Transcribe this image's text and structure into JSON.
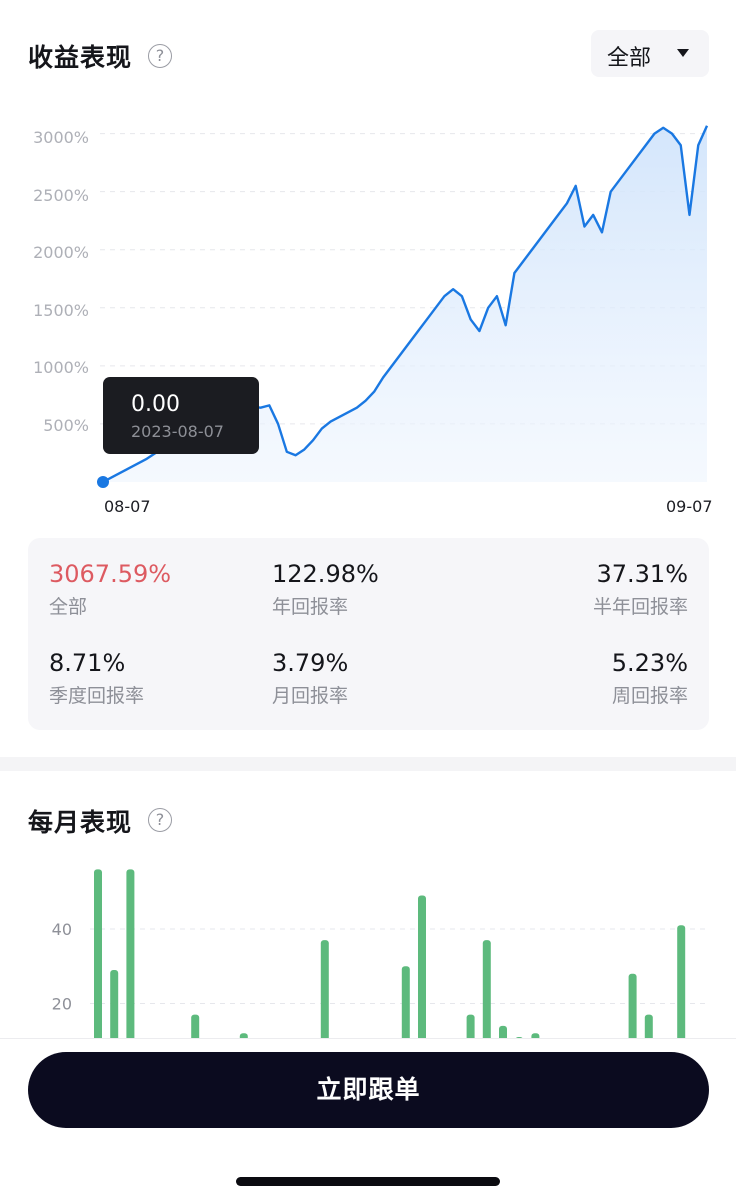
{
  "performance": {
    "title": "收益表现",
    "range_selector": "全部",
    "chart_data": {
      "type": "area",
      "x": [
        "08-07",
        "09-07"
      ],
      "ylabel": "",
      "yticks": [
        "500%",
        "1000%",
        "1500%",
        "2000%",
        "2500%",
        "3000%"
      ],
      "ylim": [
        0,
        3100
      ],
      "grid": true,
      "series": [
        {
          "values": [
            0,
            40,
            80,
            120,
            160,
            200,
            250,
            300,
            320,
            360,
            380,
            390,
            400,
            420,
            440,
            560,
            620,
            650,
            640,
            660,
            500,
            260,
            230,
            280,
            360,
            460,
            520,
            560,
            600,
            640,
            700,
            780,
            900,
            1000,
            1100,
            1200,
            1300,
            1400,
            1500,
            1600,
            1660,
            1600,
            1400,
            1300,
            1500,
            1600,
            1350,
            1800,
            1900,
            2000,
            2100,
            2200,
            2300,
            2400,
            2550,
            2200,
            2300,
            2150,
            2500,
            2600,
            2700,
            2800,
            2900,
            3000,
            3050,
            3000,
            2900,
            2300,
            2900,
            3067.59
          ]
        }
      ],
      "color": "#1a78e2"
    },
    "tooltip": {
      "value": "0.00",
      "date": "2023-08-07"
    },
    "stats": [
      {
        "value": "3067.59%",
        "label": "全部"
      },
      {
        "value": "122.98%",
        "label": "年回报率"
      },
      {
        "value": "37.31%",
        "label": "半年回报率"
      },
      {
        "value": "8.71%",
        "label": "季度回报率"
      },
      {
        "value": "3.79%",
        "label": "月回报率"
      },
      {
        "value": "5.23%",
        "label": "周回报率"
      }
    ]
  },
  "monthly": {
    "title": "每月表现",
    "chart_data": {
      "type": "bar",
      "yticks": [
        "20",
        "40"
      ],
      "values": [
        56,
        29,
        56,
        0,
        0,
        0,
        17,
        0,
        0,
        12,
        0,
        0,
        0,
        0,
        37,
        0,
        0,
        0,
        0,
        30,
        49,
        0,
        0,
        17,
        37,
        14,
        11,
        12,
        0,
        0,
        0,
        0,
        0,
        28,
        17,
        0,
        41
      ],
      "ylim": [
        0,
        60
      ],
      "color": "#5dba7d"
    }
  },
  "cta_label": "立即跟单"
}
